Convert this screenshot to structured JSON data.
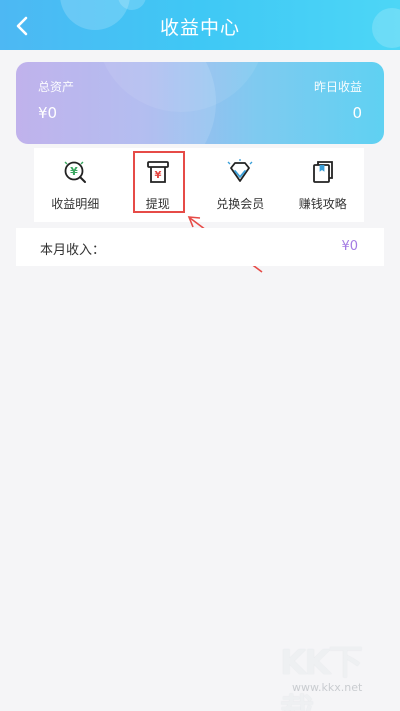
{
  "header": {
    "title": "收益中心",
    "back_icon": "chevron-left-icon"
  },
  "assets": {
    "total_label": "总资产",
    "total_value": "¥0",
    "yesterday_label": "昨日收益",
    "yesterday_value": "0"
  },
  "menu": [
    {
      "label": "收益明细",
      "icon": "magnifier-yen-icon"
    },
    {
      "label": "提现",
      "icon": "withdraw-atm-icon"
    },
    {
      "label": "兑换会员",
      "icon": "diamond-icon"
    },
    {
      "label": "赚钱攻略",
      "icon": "guide-book-icon"
    }
  ],
  "income": {
    "label": "本月收入：",
    "value": "¥0"
  },
  "watermark": {
    "logo": "KK下载",
    "site": "www.kkx.net"
  },
  "colors": {
    "header_start": "#4db8f3",
    "header_end": "#4dd6f6",
    "card_start": "#b8a8ea",
    "card_end": "#5fd1f2",
    "income_value": "#a47be3",
    "highlight": "#e64b47",
    "icon_green": "#3aa760",
    "icon_red": "#e3443f",
    "icon_blue": "#3a9fd8"
  }
}
